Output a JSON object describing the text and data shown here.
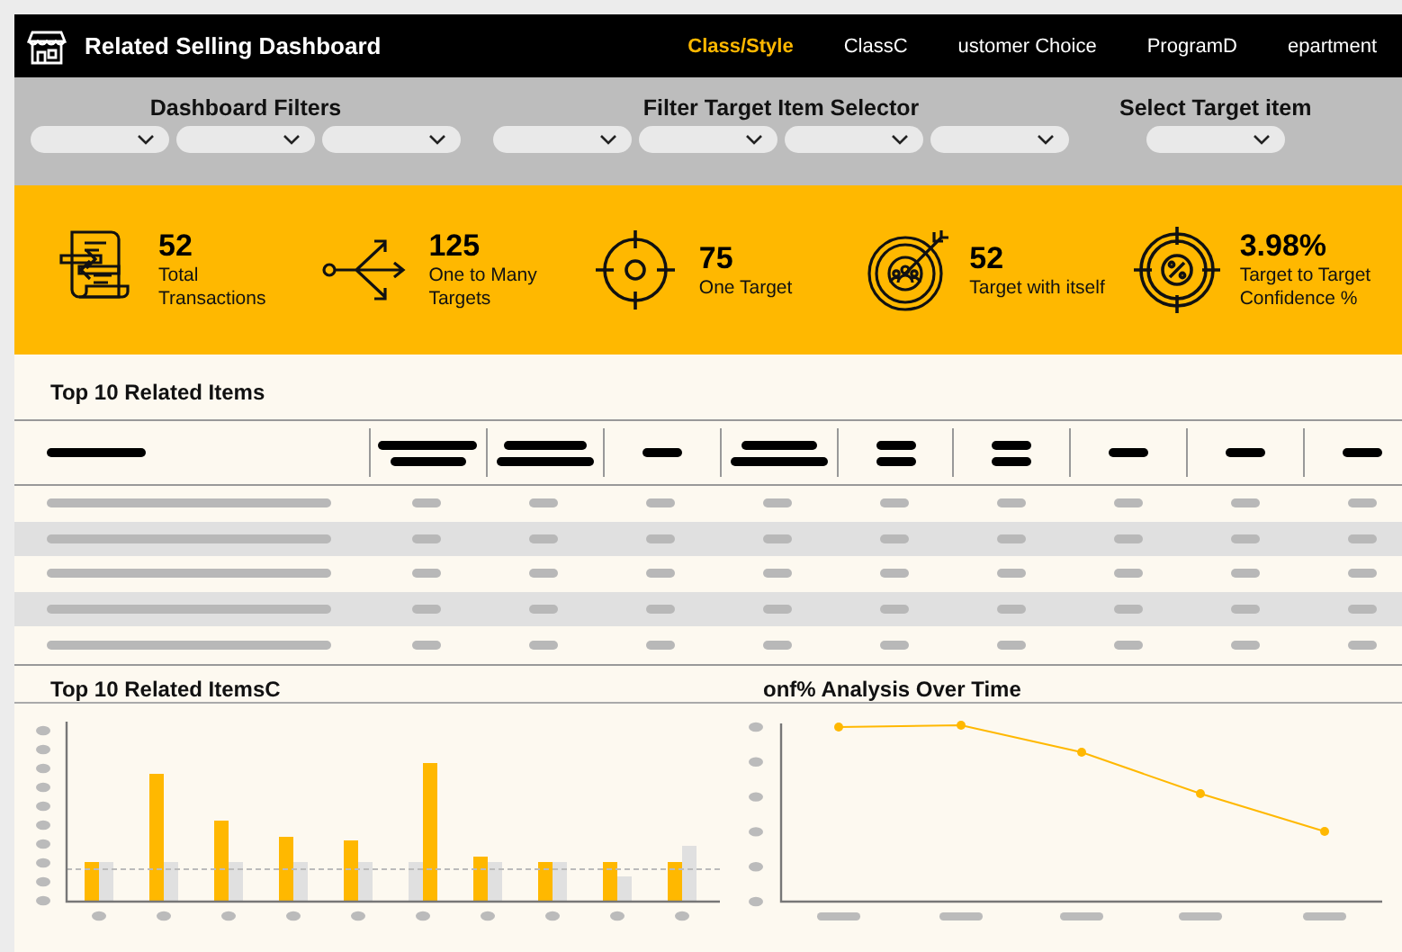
{
  "header": {
    "title": "Related Selling Dashboard",
    "tabs": [
      {
        "label": "Class/Style",
        "selected": true
      },
      {
        "label": "ClassC",
        "selected": false
      },
      {
        "label": "ustomer Choice",
        "selected": false
      },
      {
        "label": "ProgramD",
        "selected": false
      },
      {
        "label": "epartment",
        "selected": false
      }
    ]
  },
  "filter_groups": [
    {
      "title": "Dashboard Filters",
      "dropdowns": [
        {
          "expanded": false
        },
        {
          "expanded": false
        },
        {
          "expanded": false
        }
      ]
    },
    {
      "title": "Filter Target Item Selector",
      "dropdowns": [
        {
          "expanded": false
        },
        {
          "expanded": false
        },
        {
          "expanded": false
        },
        {
          "expanded": false
        }
      ]
    },
    {
      "title": "Select Target item",
      "dropdowns": [
        {
          "expanded": false
        }
      ]
    }
  ],
  "kpis": [
    {
      "kind": "document",
      "value": "52",
      "label": "Total Transactions"
    },
    {
      "kind": "branch",
      "value": "125",
      "label": "One to Many Targets"
    },
    {
      "kind": "crosshair",
      "value": "75",
      "label": "One Target"
    },
    {
      "kind": "target-people",
      "value": "52",
      "label": "Target with itself"
    },
    {
      "kind": "percent",
      "value": "3.98%",
      "label": "Target to Target Confidence %"
    }
  ],
  "table": {
    "title": "Top 10 Related Items"
  },
  "panels": [
    {
      "kind": "bar",
      "title": "Top 10 Related ItemsC"
    },
    {
      "kind": "line",
      "title": "onf% Analysis Over Time"
    }
  ]
}
